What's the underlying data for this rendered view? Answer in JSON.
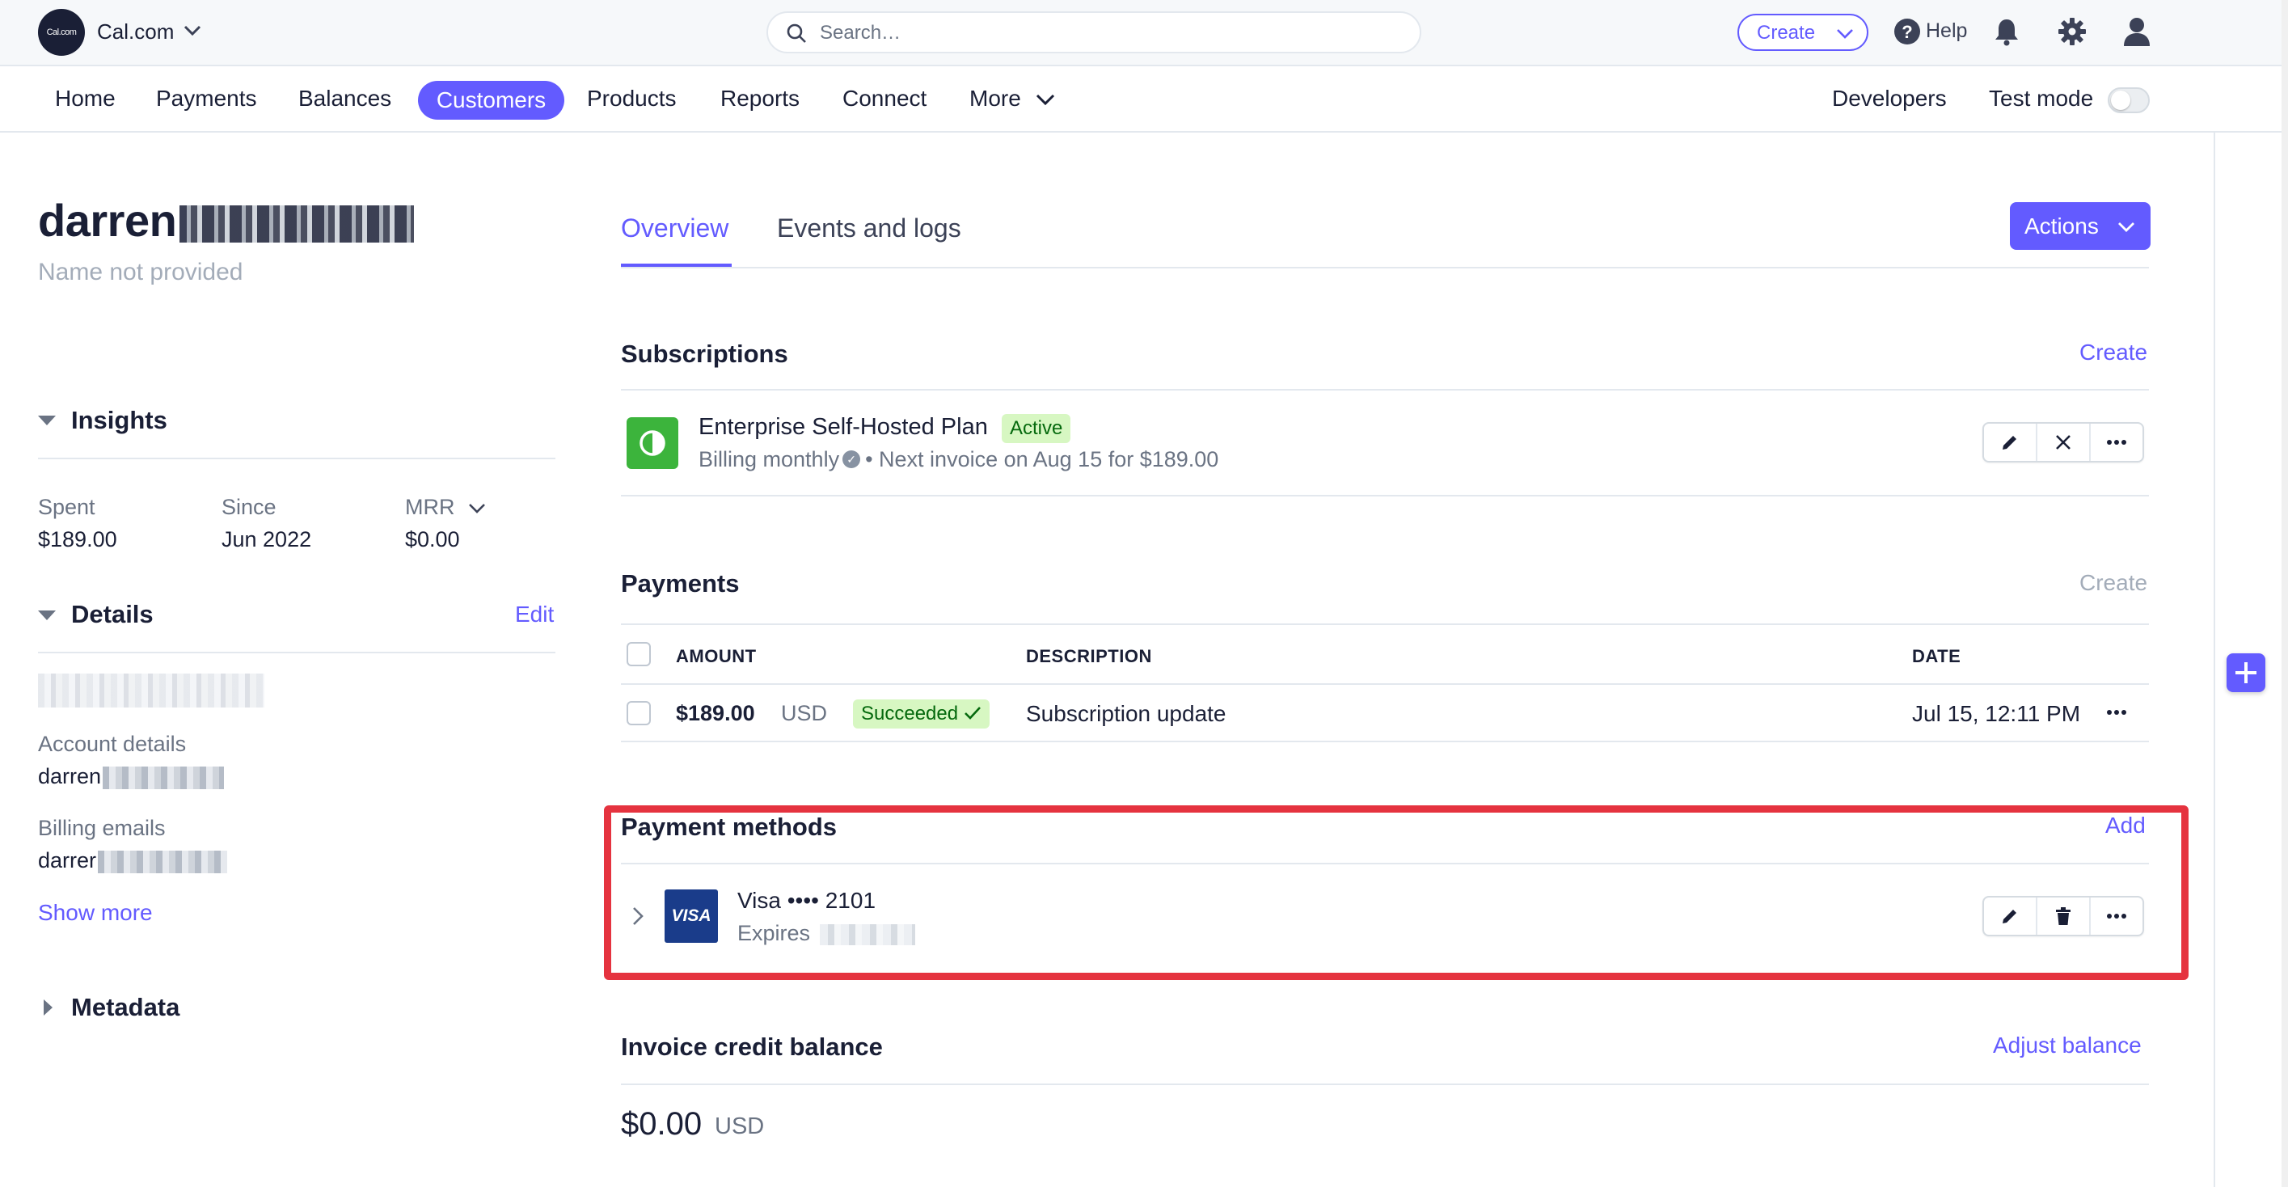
{
  "topbar": {
    "account_logo_text": "Cal.com",
    "account_name": "Cal.com",
    "search_placeholder": "Search…",
    "create_label": "Create",
    "help_label": "Help"
  },
  "nav": {
    "items": [
      "Home",
      "Payments",
      "Balances",
      "Customers",
      "Products",
      "Reports",
      "Connect",
      "More"
    ],
    "active": "Customers",
    "developers": "Developers",
    "test_mode": "Test mode"
  },
  "customer": {
    "email_visible": "darren",
    "email_domain_obscured": "stark.fund",
    "name_note": "Name not provided"
  },
  "insights": {
    "title": "Insights",
    "spent_label": "Spent",
    "spent_value": "$189.00",
    "since_label": "Since",
    "since_value": "Jun 2022",
    "mrr_label": "MRR",
    "mrr_value": "$0.00"
  },
  "details": {
    "title": "Details",
    "edit_label": "Edit",
    "account_details_label": "Account details",
    "account_details_value": "darren",
    "billing_emails_label": "Billing emails",
    "billing_emails_value": "darrer",
    "show_more": "Show more"
  },
  "metadata": {
    "title": "Metadata"
  },
  "tabs": [
    "Overview",
    "Events and logs"
  ],
  "actions_label": "Actions",
  "subscriptions": {
    "title": "Subscriptions",
    "create_label": "Create",
    "plan_name": "Enterprise Self-Hosted Plan",
    "status": "Active",
    "billing": "Billing monthly",
    "next_invoice": "• Next invoice on Aug 15 for $189.00"
  },
  "payments": {
    "title": "Payments",
    "create_label": "Create",
    "columns": [
      "AMOUNT",
      "DESCRIPTION",
      "DATE"
    ],
    "rows": [
      {
        "amount": "$189.00",
        "currency": "USD",
        "status": "Succeeded",
        "description": "Subscription update",
        "date": "Jul 15, 12:11 PM"
      }
    ]
  },
  "payment_methods": {
    "title": "Payment methods",
    "add_label": "Add",
    "card_brand_logo": "VISA",
    "card_label": "Visa •••• 2101",
    "expires_label": "Expires"
  },
  "invoice_credit": {
    "title": "Invoice credit balance",
    "adjust_label": "Adjust balance",
    "amount": "$0.00",
    "currency": "USD"
  },
  "colors": {
    "accent": "#635bff",
    "text": "#1a1f36",
    "muted": "#6a7383",
    "success_bg": "#d7f7c2",
    "success_text": "#05690d",
    "highlight": "#e5333f"
  }
}
